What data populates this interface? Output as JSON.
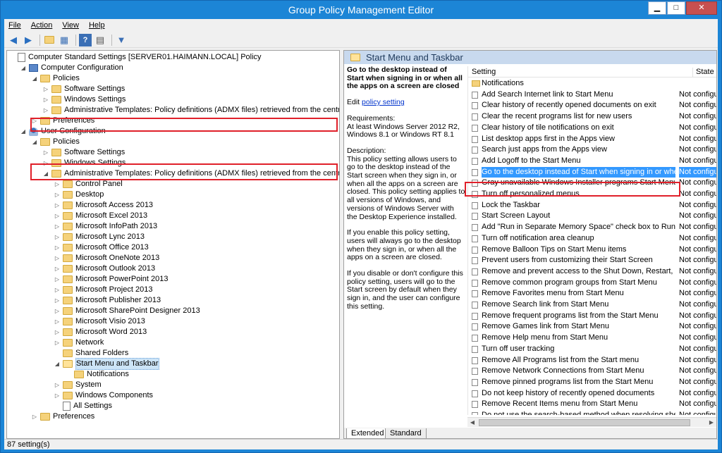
{
  "window": {
    "title": "Group Policy Management Editor",
    "minimize": "▁",
    "maximize": "□",
    "close": "✕"
  },
  "menu": [
    "File",
    "Action",
    "View",
    "Help"
  ],
  "toolbar": [
    "back-icon",
    "forward-icon",
    "up-folder-icon",
    "show-hide-tree-icon",
    "help-icon",
    "properties-icon",
    "filter-icon"
  ],
  "tree": [
    {
      "label": "Computer Standard Settings [SERVER01.HAIMANN.LOCAL] Policy",
      "level": 0,
      "exp": "",
      "icon": "doc"
    },
    {
      "label": "Computer Configuration",
      "level": 1,
      "exp": "◢",
      "icon": "comp"
    },
    {
      "label": "Policies",
      "level": 2,
      "exp": "◢",
      "icon": "folder"
    },
    {
      "label": "Software Settings",
      "level": 3,
      "exp": "▷",
      "icon": "folder"
    },
    {
      "label": "Windows Settings",
      "level": 3,
      "exp": "▷",
      "icon": "folder"
    },
    {
      "label": "Administrative Templates: Policy definitions (ADMX files) retrieved from the central store.",
      "level": 3,
      "exp": "▷",
      "icon": "folder"
    },
    {
      "label": "Preferences",
      "level": 2,
      "exp": "▷",
      "icon": "folder"
    },
    {
      "label": "User Configuration",
      "level": 1,
      "exp": "◢",
      "icon": "user"
    },
    {
      "label": "Policies",
      "level": 2,
      "exp": "◢",
      "icon": "folder"
    },
    {
      "label": "Software Settings",
      "level": 3,
      "exp": "▷",
      "icon": "folder"
    },
    {
      "label": "Windows Settings",
      "level": 3,
      "exp": "▷",
      "icon": "folder"
    },
    {
      "label": "Administrative Templates: Policy definitions (ADMX files) retrieved from the central store.",
      "level": 3,
      "exp": "◢",
      "icon": "folder"
    },
    {
      "label": "Control Panel",
      "level": 4,
      "exp": "▷",
      "icon": "folder"
    },
    {
      "label": "Desktop",
      "level": 4,
      "exp": "▷",
      "icon": "folder"
    },
    {
      "label": "Microsoft Access 2013",
      "level": 4,
      "exp": "▷",
      "icon": "folder"
    },
    {
      "label": "Microsoft Excel 2013",
      "level": 4,
      "exp": "▷",
      "icon": "folder"
    },
    {
      "label": "Microsoft InfoPath 2013",
      "level": 4,
      "exp": "▷",
      "icon": "folder"
    },
    {
      "label": "Microsoft Lync 2013",
      "level": 4,
      "exp": "▷",
      "icon": "folder"
    },
    {
      "label": "Microsoft Office 2013",
      "level": 4,
      "exp": "▷",
      "icon": "folder"
    },
    {
      "label": "Microsoft OneNote 2013",
      "level": 4,
      "exp": "▷",
      "icon": "folder"
    },
    {
      "label": "Microsoft Outlook 2013",
      "level": 4,
      "exp": "▷",
      "icon": "folder"
    },
    {
      "label": "Microsoft PowerPoint 2013",
      "level": 4,
      "exp": "▷",
      "icon": "folder"
    },
    {
      "label": "Microsoft Project 2013",
      "level": 4,
      "exp": "▷",
      "icon": "folder"
    },
    {
      "label": "Microsoft Publisher 2013",
      "level": 4,
      "exp": "▷",
      "icon": "folder"
    },
    {
      "label": "Microsoft SharePoint Designer 2013",
      "level": 4,
      "exp": "▷",
      "icon": "folder"
    },
    {
      "label": "Microsoft Visio 2013",
      "level": 4,
      "exp": "▷",
      "icon": "folder"
    },
    {
      "label": "Microsoft Word 2013",
      "level": 4,
      "exp": "▷",
      "icon": "folder"
    },
    {
      "label": "Network",
      "level": 4,
      "exp": "▷",
      "icon": "folder"
    },
    {
      "label": "Shared Folders",
      "level": 4,
      "exp": "",
      "icon": "folder"
    },
    {
      "label": "Start Menu and Taskbar",
      "level": 4,
      "exp": "◢",
      "icon": "folder-open",
      "selected": true
    },
    {
      "label": "Notifications",
      "level": 5,
      "exp": "",
      "icon": "folder"
    },
    {
      "label": "System",
      "level": 4,
      "exp": "▷",
      "icon": "folder"
    },
    {
      "label": "Windows Components",
      "level": 4,
      "exp": "▷",
      "icon": "folder"
    },
    {
      "label": "All Settings",
      "level": 4,
      "exp": "",
      "icon": "doc"
    },
    {
      "label": "Preferences",
      "level": 2,
      "exp": "▷",
      "icon": "folder"
    }
  ],
  "right": {
    "header": "Start Menu and Taskbar",
    "desc_title": "Go to the desktop instead of Start when signing in or when all the apps on a screen are closed",
    "edit_prefix": "Edit ",
    "edit_link": "policy setting",
    "req_label": "Requirements:",
    "req_text": "At least Windows Server 2012 R2, Windows 8.1 or Windows RT 8.1",
    "desc_label": "Description:",
    "desc_1": "This policy setting allows users to go to the desktop instead of the Start screen when they sign in, or when all the apps on a screen are closed.  This policy setting applies to all versions of Windows, and versions of Windows Server with the Desktop Experience installed.",
    "desc_2": "If you enable this policy setting, users will always go to the desktop when they sign in, or when all the apps on a screen are closed.",
    "desc_3": "If you disable or don't configure this policy setting, users will go to the Start screen by default when they sign in, and the user can configure this setting.",
    "col_setting": "Setting",
    "col_state": "State",
    "rows": [
      {
        "name": "Notifications",
        "state": "",
        "folder": true
      },
      {
        "name": "Add Search Internet link to Start Menu",
        "state": "Not configured"
      },
      {
        "name": "Clear history of recently opened documents on exit",
        "state": "Not configured"
      },
      {
        "name": "Clear the recent programs list for new users",
        "state": "Not configured"
      },
      {
        "name": "Clear history of tile notifications on exit",
        "state": "Not configured"
      },
      {
        "name": "List desktop apps first in the Apps view",
        "state": "Not configured"
      },
      {
        "name": "Search just apps from the Apps view",
        "state": "Not configured"
      },
      {
        "name": "Add Logoff to the Start Menu",
        "state": "Not configured"
      },
      {
        "name": "Go to the desktop instead of Start when signing in or when ...",
        "state": "Not configured",
        "selected": true
      },
      {
        "name": "Gray unavailable Windows Installer programs Start Menu sh...",
        "state": "Not configured"
      },
      {
        "name": "Turn off personalized menus",
        "state": "Not configured"
      },
      {
        "name": "Lock the Taskbar",
        "state": "Not configured"
      },
      {
        "name": "Start Screen Layout",
        "state": "Not configured"
      },
      {
        "name": "Add \"Run in Separate Memory Space\" check box to Run dial...",
        "state": "Not configured"
      },
      {
        "name": "Turn off notification area cleanup",
        "state": "Not configured"
      },
      {
        "name": "Remove Balloon Tips on Start Menu items",
        "state": "Not configured"
      },
      {
        "name": "Prevent users from customizing their Start Screen",
        "state": "Not configured"
      },
      {
        "name": "Remove and prevent access to the Shut Down, Restart, Sleep...",
        "state": "Not configured"
      },
      {
        "name": "Remove common program groups from Start Menu",
        "state": "Not configured"
      },
      {
        "name": "Remove Favorites menu from Start Menu",
        "state": "Not configured"
      },
      {
        "name": "Remove Search link from Start Menu",
        "state": "Not configured"
      },
      {
        "name": "Remove frequent programs list from the Start Menu",
        "state": "Not configured"
      },
      {
        "name": "Remove Games link from Start Menu",
        "state": "Not configured"
      },
      {
        "name": "Remove Help menu from Start Menu",
        "state": "Not configured"
      },
      {
        "name": "Turn off user tracking",
        "state": "Not configured"
      },
      {
        "name": "Remove All Programs list from the Start menu",
        "state": "Not configured"
      },
      {
        "name": "Remove Network Connections from Start Menu",
        "state": "Not configured"
      },
      {
        "name": "Remove pinned programs list from the Start Menu",
        "state": "Not configured"
      },
      {
        "name": "Do not keep history of recently opened documents",
        "state": "Not configured"
      },
      {
        "name": "Remove Recent Items menu from Start Menu",
        "state": "Not configured"
      },
      {
        "name": "Do not use the search-based method when resolving shell s...",
        "state": "Not configured"
      }
    ],
    "tab_extended": "Extended",
    "tab_standard": "Standard"
  },
  "status": "87 setting(s)"
}
